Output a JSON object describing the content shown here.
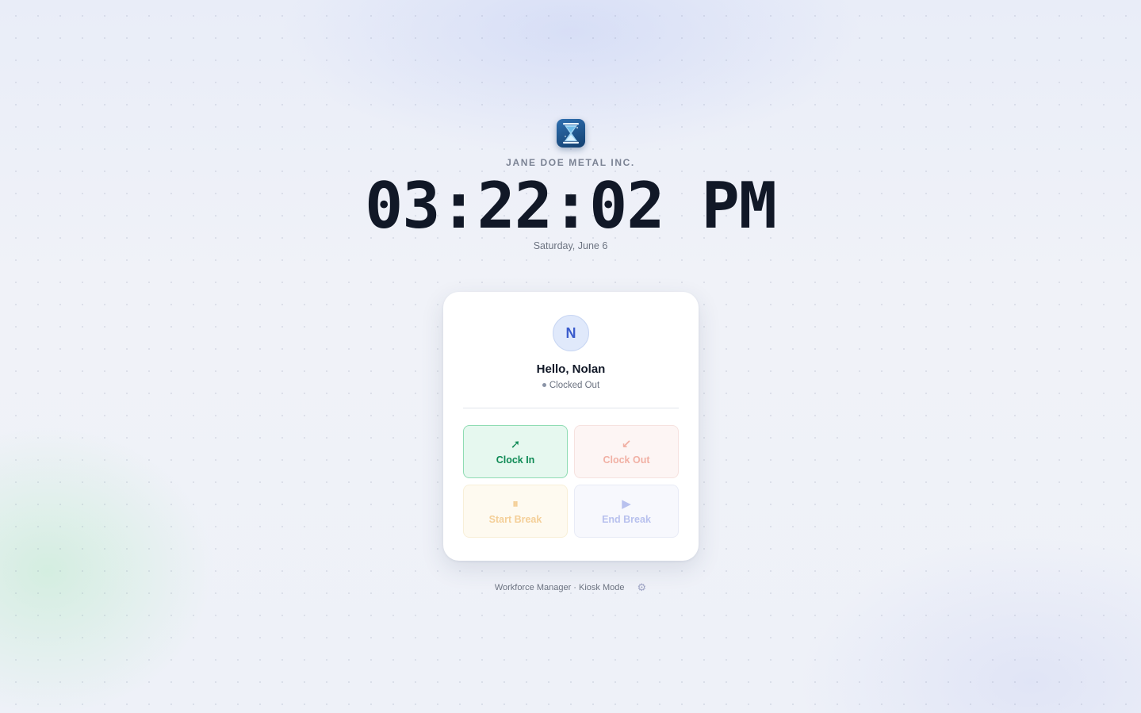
{
  "header": {
    "logo_icon": "hourglass-icon",
    "company": "JANE DOE METAL INC.",
    "time": "03:22:02 PM",
    "date": "Saturday, June 6"
  },
  "card": {
    "avatar_initial": "N",
    "greeting": "Hello, Nolan",
    "status": "Clocked Out",
    "buttons": [
      {
        "label": "Clock In",
        "icon": "arrow-up-right-icon",
        "glyph": "➚",
        "enabled": true,
        "color": "#0f8a55"
      },
      {
        "label": "Clock Out",
        "icon": "arrow-down-left-icon",
        "glyph": "↙",
        "enabled": false,
        "color": "#f1b0a4"
      },
      {
        "label": "Start Break",
        "icon": "pause-icon",
        "glyph": "⏸",
        "enabled": false,
        "color": "#f4cf98"
      },
      {
        "label": "End Break",
        "icon": "play-icon",
        "glyph": "▶",
        "enabled": false,
        "color": "#b8c1ee"
      }
    ]
  },
  "footer": {
    "text": "Workforce Manager · Kiosk Mode",
    "settings_icon": "gear-icon",
    "settings_glyph": "⚙"
  }
}
